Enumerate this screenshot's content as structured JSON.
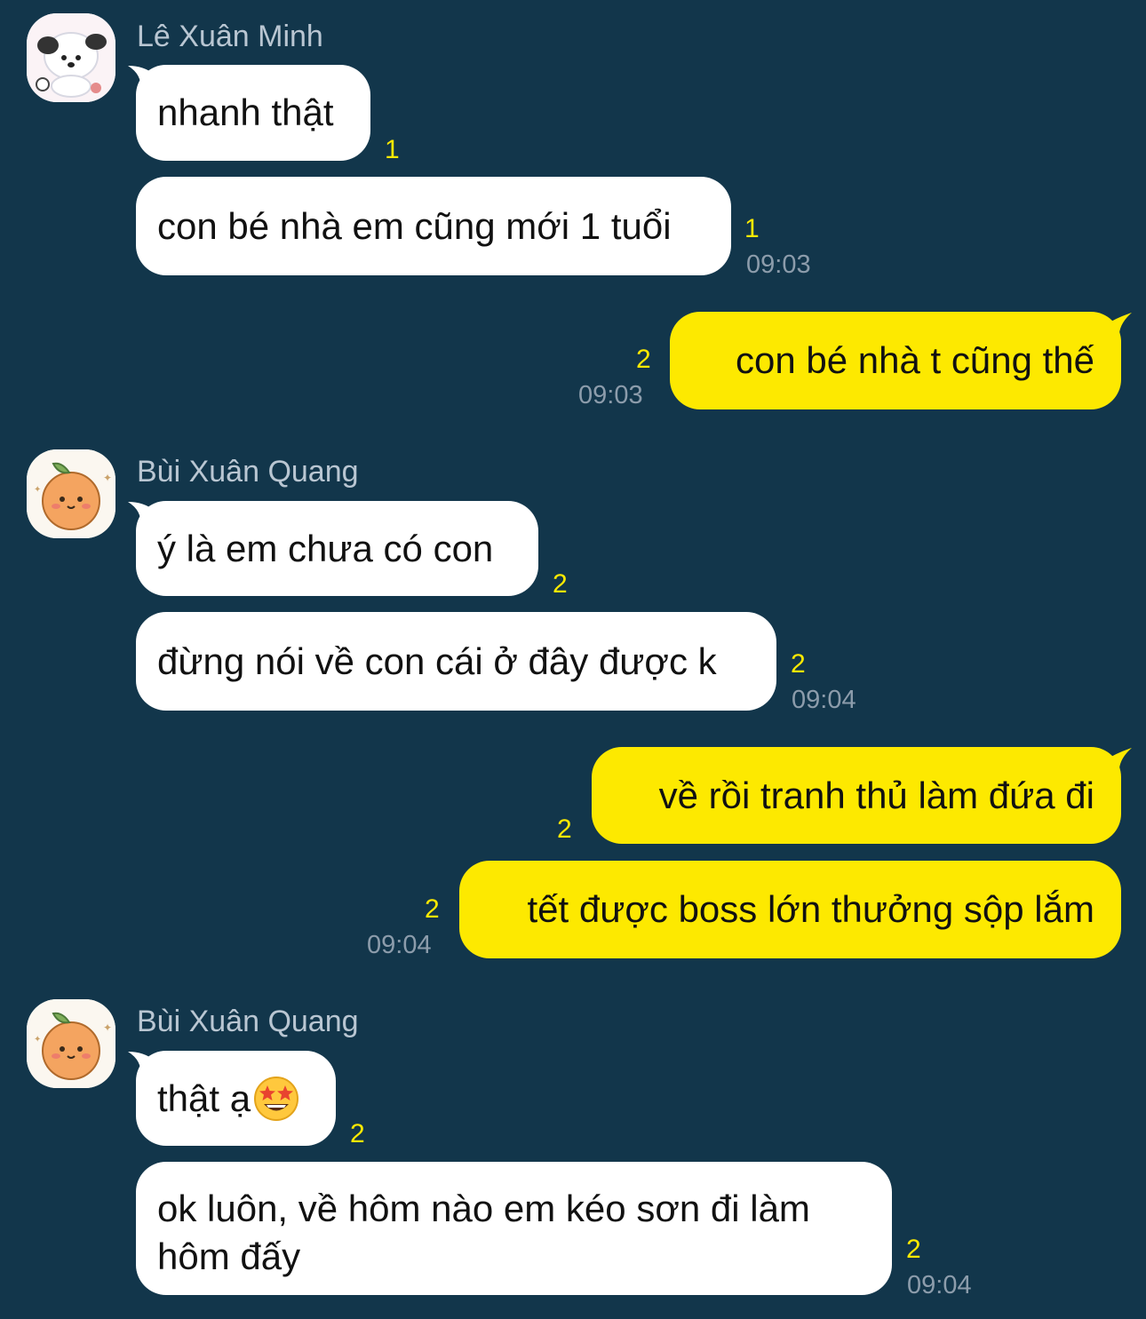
{
  "chat": {
    "sender1": {
      "name": "Lê Xuân Minh"
    },
    "sender2": {
      "name": "Bùi Xuân Quang"
    },
    "m1": {
      "text": "nhanh thật",
      "unread": "1"
    },
    "m2": {
      "text": "con bé nhà em cũng mới 1 tuổi",
      "unread": "1",
      "time": "09:03"
    },
    "m3": {
      "text": "con bé nhà t cũng thế",
      "unread": "2",
      "time": "09:03"
    },
    "m4": {
      "text": "ý là em chưa có con",
      "unread": "2"
    },
    "m5": {
      "text": "đừng nói về con cái ở đây được k",
      "unread": "2",
      "time": "09:04"
    },
    "m6": {
      "text": "về rồi tranh thủ làm đứa đi",
      "unread": "2"
    },
    "m7": {
      "text": "tết được boss lớn thưởng sộp lắm",
      "unread": "2",
      "time": "09:04"
    },
    "m8": {
      "text": "thật ạ",
      "emoji": "star-struck-emoji",
      "unread": "2"
    },
    "m9": {
      "text": "ok luôn, về hôm nào em kéo sơn đi làm hôm đấy",
      "unread": "2",
      "time": "09:04"
    }
  },
  "colors": {
    "background": "#12364b",
    "incoming_bubble": "#ffffff",
    "outgoing_bubble": "#fde900",
    "unread_count": "#fde900",
    "timestamp": "#8c9cab",
    "sender_name": "#b9c6d2"
  },
  "icons": {
    "avatar1": "dog-avatar",
    "avatar2": "orange-avatar"
  }
}
